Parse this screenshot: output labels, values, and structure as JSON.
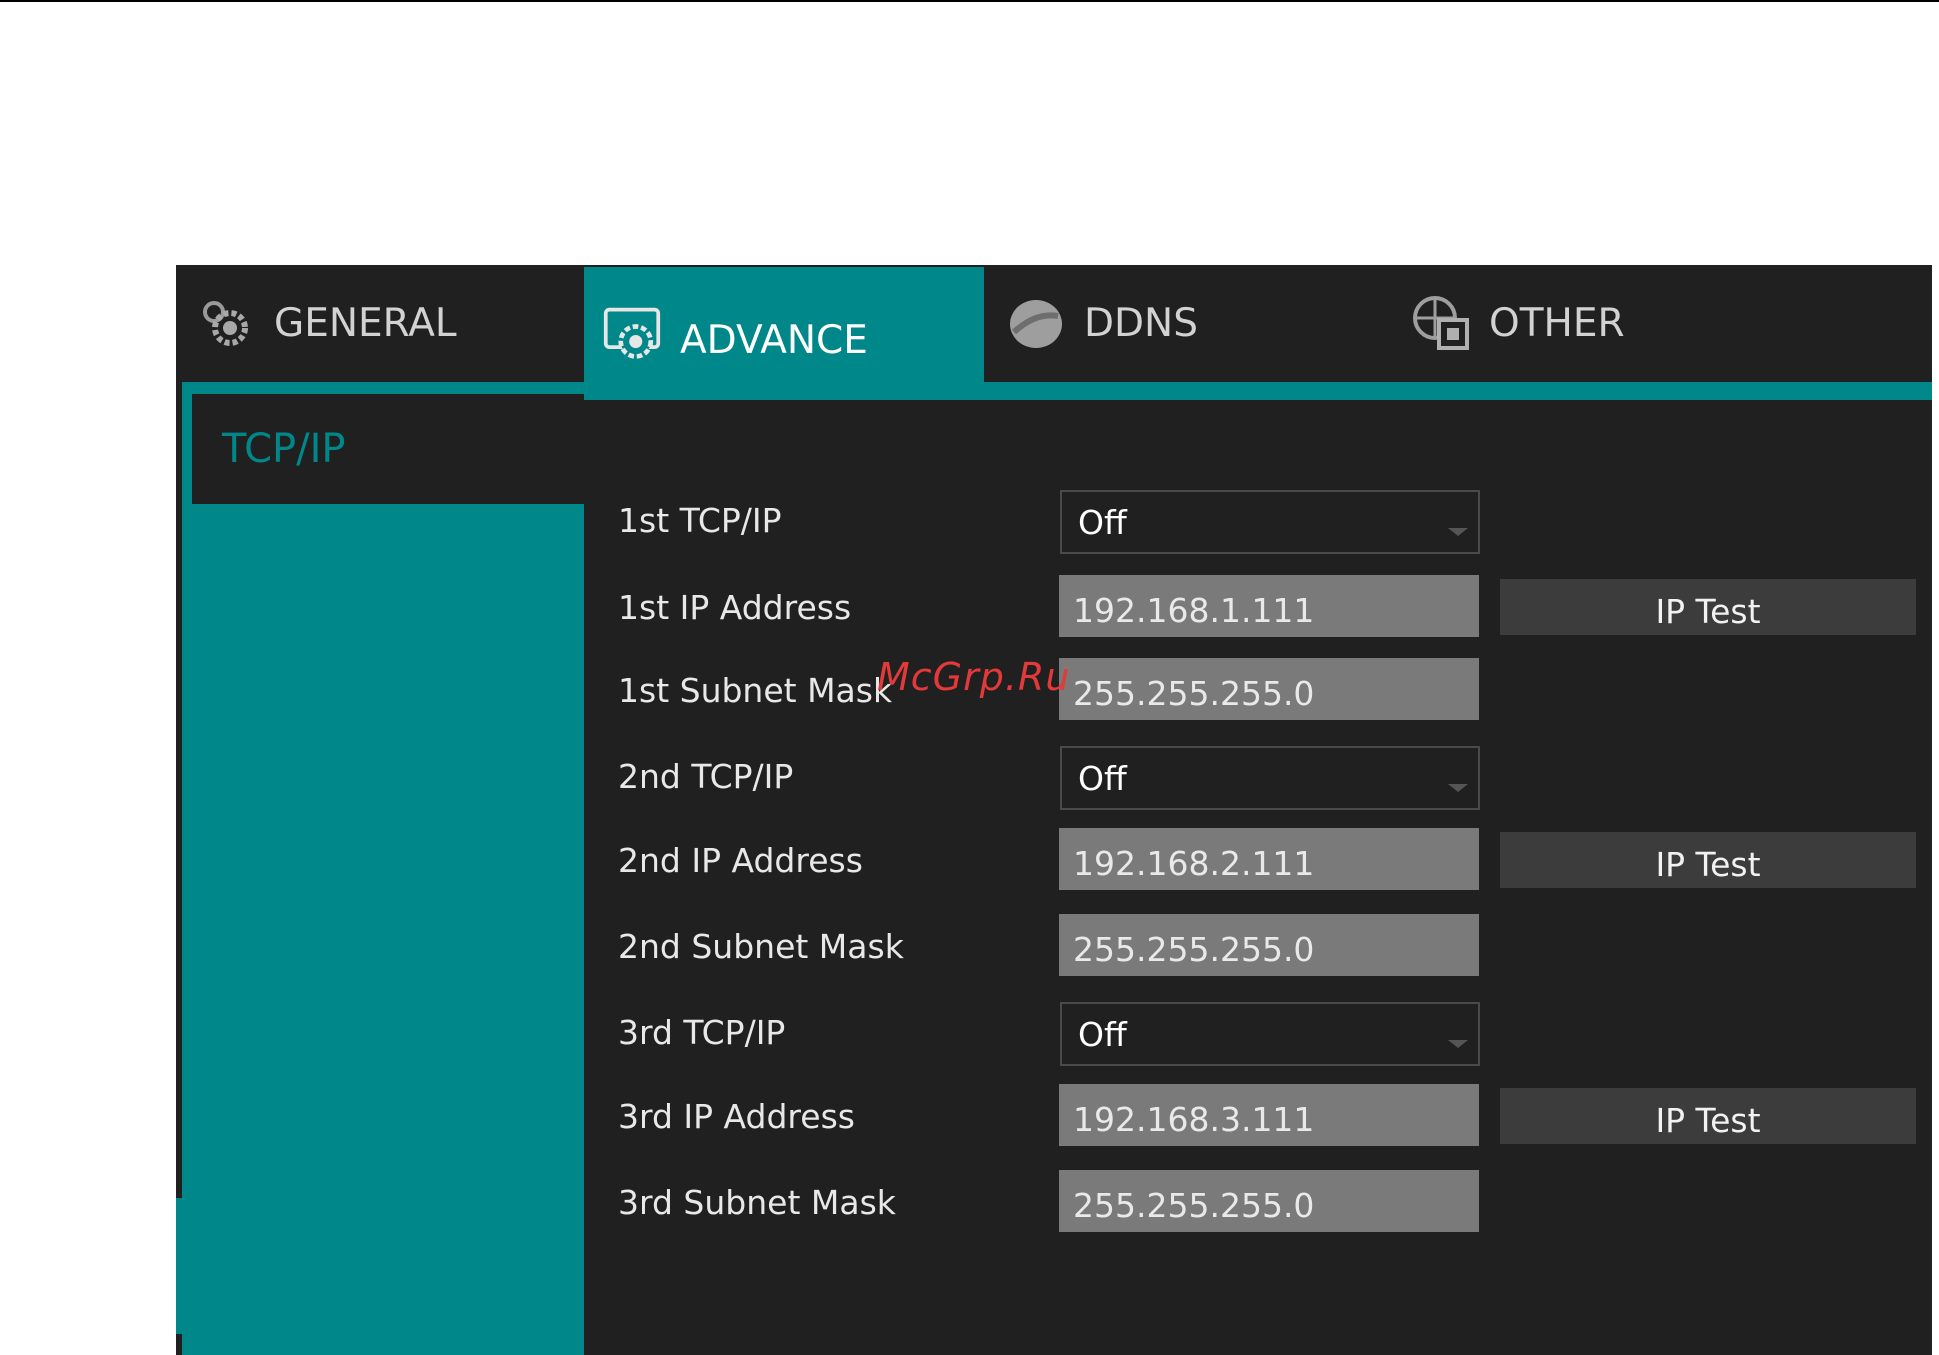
{
  "tabs": [
    {
      "label": "GENERAL",
      "icon": "gear-icon"
    },
    {
      "label": "ADVANCE",
      "icon": "settings-panel-icon"
    },
    {
      "label": "DDNS",
      "icon": "ddns-disc-icon"
    },
    {
      "label": "OTHER",
      "icon": "globe-monitor-icon"
    }
  ],
  "active_tab": "ADVANCE",
  "sidebar": {
    "items": [
      {
        "label": "TCP/IP"
      }
    ]
  },
  "rows": [
    {
      "label": "1st TCP/IP",
      "type": "select",
      "value": "Off"
    },
    {
      "label": "1st IP Address",
      "type": "input",
      "value": "192.168.1.111",
      "button": "IP Test"
    },
    {
      "label": "1st Subnet Mask",
      "type": "input",
      "value": "255.255.255.0"
    },
    {
      "label": "2nd TCP/IP",
      "type": "select",
      "value": "Off"
    },
    {
      "label": "2nd IP Address",
      "type": "input",
      "value": "192.168.2.111",
      "button": "IP Test"
    },
    {
      "label": "2nd Subnet Mask",
      "type": "input",
      "value": "255.255.255.0"
    },
    {
      "label": "3rd TCP/IP",
      "type": "select",
      "value": "Off"
    },
    {
      "label": "3rd IP Address",
      "type": "input",
      "value": "192.168.3.111",
      "button": "IP Test"
    },
    {
      "label": "3rd Subnet Mask",
      "type": "input",
      "value": "255.255.255.0"
    }
  ],
  "watermark": "McGrp.Ru",
  "colors": {
    "accent": "#00878a",
    "background": "#202020",
    "input_bg": "#7a7a7a",
    "button_bg": "#3c3c3c"
  }
}
